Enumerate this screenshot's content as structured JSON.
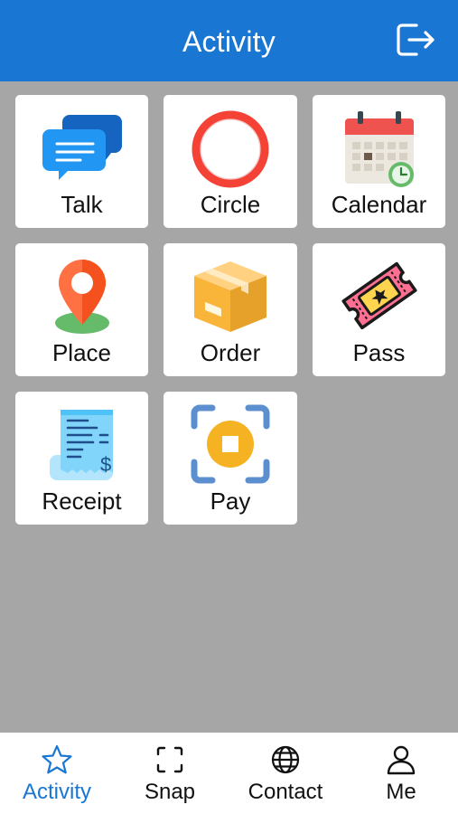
{
  "header": {
    "title": "Activity",
    "logout_icon": "logout-icon",
    "background": "#1976d2"
  },
  "tiles": [
    {
      "label": "Talk",
      "icon": "chat-bubbles-icon"
    },
    {
      "label": "Circle",
      "icon": "circle-icon"
    },
    {
      "label": "Calendar",
      "icon": "calendar-icon"
    },
    {
      "label": "Place",
      "icon": "location-pin-icon"
    },
    {
      "label": "Order",
      "icon": "package-box-icon"
    },
    {
      "label": "Pass",
      "icon": "ticket-icon"
    },
    {
      "label": "Receipt",
      "icon": "receipt-icon"
    },
    {
      "label": "Pay",
      "icon": "scan-pay-icon"
    }
  ],
  "tabbar": {
    "active": "Activity",
    "tabs": [
      {
        "label": "Activity",
        "icon": "star-icon"
      },
      {
        "label": "Snap",
        "icon": "scan-frame-icon"
      },
      {
        "label": "Contact",
        "icon": "globe-icon"
      },
      {
        "label": "Me",
        "icon": "person-icon"
      }
    ]
  },
  "colors": {
    "accent": "#1976d2",
    "background": "#a6a6a6",
    "tile": "#ffffff"
  }
}
